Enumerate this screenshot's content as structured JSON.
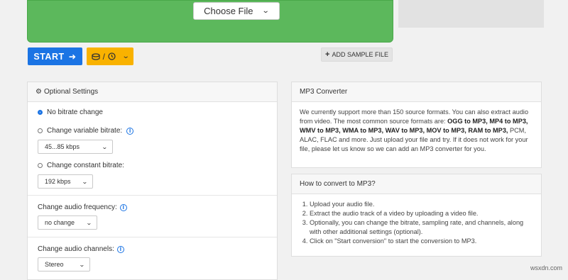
{
  "upload": {
    "choose_label": "Choose File"
  },
  "toolbar": {
    "start_label": "START",
    "sample_label": "ADD SAMPLE FILE"
  },
  "settings": {
    "title": "Optional Settings",
    "no_bitrate": "No bitrate change",
    "variable_bitrate": "Change variable bitrate:",
    "variable_value": "45...85 kbps",
    "constant_bitrate": "Change constant bitrate:",
    "constant_value": "192 kbps",
    "frequency_label": "Change audio frequency:",
    "frequency_value": "no change",
    "channels_label": "Change audio channels:",
    "channels_value": "Stereo"
  },
  "converter": {
    "title": "MP3 Converter",
    "p1": "We currently support more than 150 source formats. You can also extract audio from video. The most common source formats are: ",
    "formats": "OGG to MP3, MP4 to MP3, WMV to MP3, WMA to MP3, WAV to MP3, MOV to MP3, RAM to MP3,",
    "p2": " PCM, ALAC, FLAC and more. Just upload your file and try. If it does not work for your file, please let us know so we can add an MP3 converter for you."
  },
  "howto": {
    "title": "How to convert to MP3?",
    "steps": [
      "Upload your audio file.",
      "Extract the audio track of a video by uploading a video file.",
      "Optionally, you can change the bitrate, sampling rate, and channels, along with other additional settings (optional).",
      "Click on \"Start conversion\" to start the conversion to MP3."
    ]
  },
  "watermark": "wsxdn.com",
  "colors": {
    "upload": "#5cb85c",
    "start": "#1b74e4",
    "options": "#f9b200"
  }
}
